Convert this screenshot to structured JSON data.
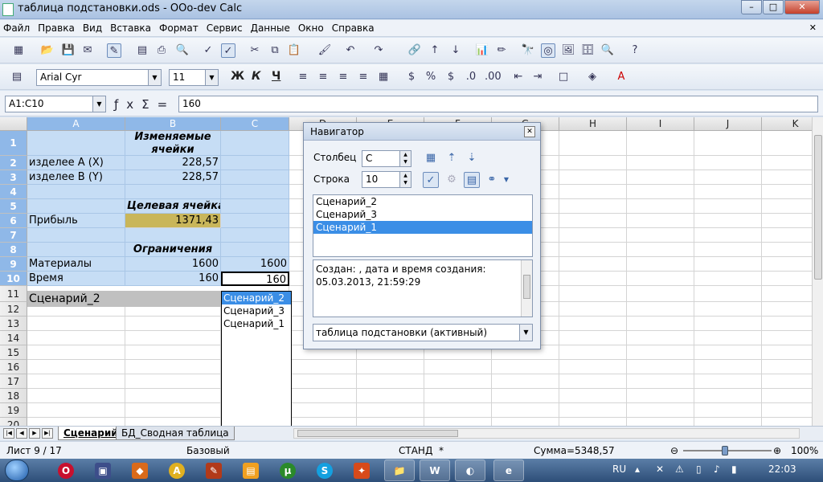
{
  "window": {
    "title": "таблица подстановки.ods - OOo-dev Calc",
    "buttons": [
      "–",
      "□",
      "✕"
    ]
  },
  "menu": [
    "Файл",
    "Правка",
    "Вид",
    "Вставка",
    "Формат",
    "Сервис",
    "Данные",
    "Окно",
    "Справка"
  ],
  "menu_close": "✕",
  "format_bar": {
    "font_name": "Arial Cyr",
    "font_size": "11",
    "bold": "Ж",
    "italic": "К",
    "underline": "Ч"
  },
  "formula_bar": {
    "cell_ref": "A1:C10",
    "value": "160"
  },
  "columns": [
    "A",
    "B",
    "C",
    "D",
    "E",
    "F",
    "G",
    "H",
    "I",
    "J",
    "K"
  ],
  "rows": [
    "1",
    "2",
    "3",
    "4",
    "5",
    "6",
    "7",
    "8",
    "9",
    "10",
    "11",
    "12",
    "13",
    "14",
    "15",
    "16",
    "17",
    "18",
    "19",
    "20"
  ],
  "sheet": {
    "b1": "Изменяемые ячейки",
    "a2": "изделее А (X)",
    "b2": "228,57",
    "a3": "изделее В (Y)",
    "b3": "228,57",
    "b5": "Целевая ячейка",
    "a6": "Прибыль",
    "b6": "1371,43",
    "b8": "Ограничения",
    "a9": "Материалы",
    "b9": "1600",
    "c9": "1600",
    "a10": "Время",
    "b10": "160",
    "c10": "160"
  },
  "scenario_selector": {
    "current": "Сценарий_2",
    "options": [
      "Сценарий_2",
      "Сценарий_3",
      "Сценарий_1"
    ]
  },
  "navigator": {
    "title": "Навигатор",
    "column_label": "Столбец",
    "column_value": "C",
    "row_label": "Строка",
    "row_value": "10",
    "scenarios": [
      "Сценарий_2",
      "Сценарий_3",
      "Сценарий_1"
    ],
    "selected_scenario": "Сценарий_1",
    "description": "Создан:  , дата и время создания: 05.03.2013, 21:59:29",
    "document": "таблица подстановки (активный)"
  },
  "sheet_tabs": [
    "Сценарий",
    "БД_Сводная таблица"
  ],
  "status": {
    "sheet": "Лист 9 / 17",
    "style": "Базовый",
    "mode": "СТАНД",
    "modified": "*",
    "sum": "Сумма=5348,57",
    "zoom": "100%"
  },
  "taskbar": {
    "lang": "RU",
    "time": "22:03"
  },
  "colors": {
    "selection": "#c6ddf5",
    "header_selected": "#8fb8e8",
    "target_cell": "#c9b65a",
    "list_highlight": "#3b8ee6"
  }
}
